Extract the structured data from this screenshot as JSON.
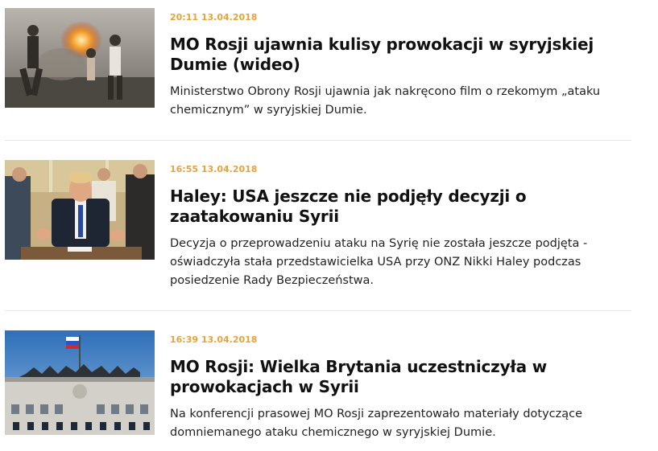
{
  "articles": [
    {
      "datetime": "20:11 13.04.2018",
      "title": "MO Rosji ujawnia kulisy prowokacji w syryjskiej Dumie (wideo)",
      "lead": "Ministerstwo Obrony Rosji ujawnia jak nakręcono film o rzekomym „ataku chemicznym” w syryjskiej Dumie."
    },
    {
      "datetime": "16:55 13.04.2018",
      "title": "Haley: USA jeszcze nie podjęły decyzji o zaatakowaniu Syrii",
      "lead": "Decyzja o przeprowadzeniu ataku na Syrię nie została jeszcze podjęta - oświadczyła stała przedstawicielka USA przy ONZ Nikki Haley podczas posiedzenie Rady Bezpieczeństwa."
    },
    {
      "datetime": "16:39 13.04.2018",
      "title": "MO Rosji: Wielka Brytania uczestniczyła w prowokacjach w Syrii",
      "lead": "Na konferencji prasowej MO Rosji zaprezentowało materiały dotyczące domniemanego ataku chemicznego w syryjskiej Dumie."
    }
  ],
  "colors": {
    "datetime": "#e8a33a",
    "title": "#111111",
    "divider": "#e6e6e6"
  }
}
